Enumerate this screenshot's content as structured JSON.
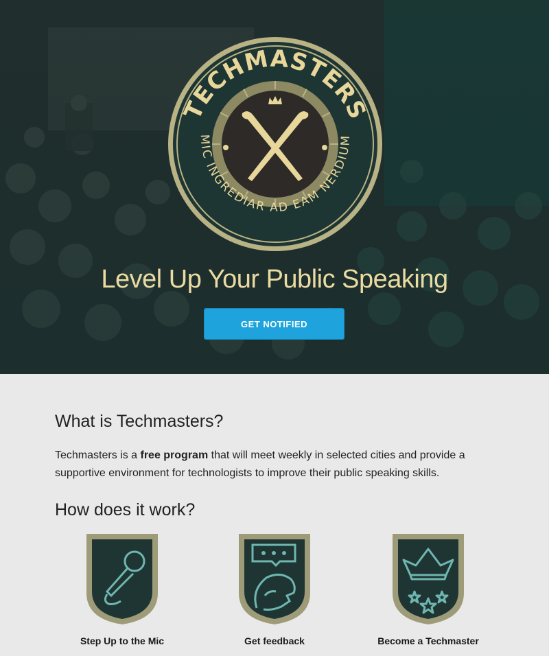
{
  "hero": {
    "emblem": {
      "arc_title": "TECHMASTERS",
      "arc_motto": "MIC INGREDIAR AD EAM NERDIUM"
    },
    "title": "Level Up Your Public Speaking",
    "cta_label": "GET NOTIFIED"
  },
  "about": {
    "heading": "What is Techmasters?",
    "text_before": "Techmasters is a ",
    "text_bold": "free program",
    "text_after": " that will meet weekly in selected cities and provide a supportive environment for technologists to improve their public speaking skills."
  },
  "how": {
    "heading": "How does it work?",
    "steps": [
      {
        "label": "Step Up to the Mic",
        "icon": "microphone-icon"
      },
      {
        "label": "Get feedback",
        "icon": "speech-lion-icon"
      },
      {
        "label": "Become a Techmaster",
        "icon": "crown-stars-icon"
      }
    ]
  },
  "colors": {
    "cream": "#eadba2",
    "accent_blue": "#1fa3dd",
    "badge_dark": "#1e3533",
    "badge_border": "#9e9c78",
    "badge_line": "#6fb6b1"
  }
}
